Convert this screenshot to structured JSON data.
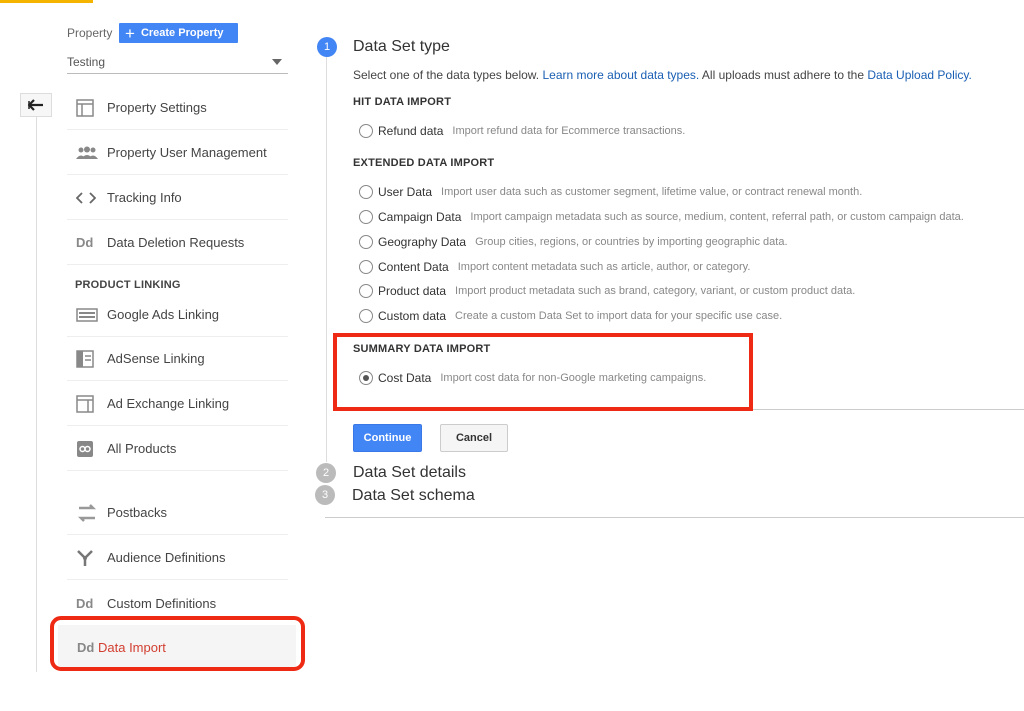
{
  "sidebar": {
    "property_label": "Property",
    "create_property_label": "Create Property",
    "property_value": "Testing",
    "items": [
      {
        "label": "Property Settings"
      },
      {
        "label": "Property User Management"
      },
      {
        "label": "Tracking Info"
      },
      {
        "label": "Data Deletion Requests",
        "icon_text": "Dd"
      }
    ],
    "product_linking_header": "PRODUCT LINKING",
    "linking_items": [
      {
        "label": "Google Ads Linking"
      },
      {
        "label": "AdSense Linking"
      },
      {
        "label": "Ad Exchange Linking"
      },
      {
        "label": "All Products"
      }
    ],
    "more_items": [
      {
        "label": "Postbacks"
      },
      {
        "label": "Audience Definitions"
      },
      {
        "label": "Custom Definitions",
        "icon_text": "Dd"
      },
      {
        "label": "Data Import",
        "icon_text": "Dd",
        "active": true
      }
    ]
  },
  "main": {
    "steps": [
      {
        "number": "1",
        "title": "Data Set type"
      },
      {
        "number": "2",
        "title": "Data Set details"
      },
      {
        "number": "3",
        "title": "Data Set schema"
      }
    ],
    "description": {
      "prefix": "Select one of the data types below. ",
      "link1": "Learn more about data types.",
      "middle": " All uploads must adhere to the ",
      "link2": "Data Upload Policy."
    },
    "groups": {
      "hit": {
        "title": "HIT DATA IMPORT",
        "options": [
          {
            "name": "Refund data",
            "note": "Import refund data for Ecommerce transactions."
          }
        ]
      },
      "extended": {
        "title": "EXTENDED DATA IMPORT",
        "options": [
          {
            "name": "User Data",
            "note": "Import user data such as customer segment, lifetime value, or contract renewal month."
          },
          {
            "name": "Campaign Data",
            "note": "Import campaign metadata such as source, medium, content, referral path, or custom campaign data."
          },
          {
            "name": "Geography Data",
            "note": "Group cities, regions, or countries by importing geographic data."
          },
          {
            "name": "Content Data",
            "note": "Import content metadata such as article, author, or category."
          },
          {
            "name": "Product data",
            "note": "Import product metadata such as brand, category, variant, or custom product data."
          },
          {
            "name": "Custom data",
            "note": "Create a custom Data Set to import data for your specific use case."
          }
        ]
      },
      "summary": {
        "title": "SUMMARY DATA IMPORT",
        "options": [
          {
            "name": "Cost Data",
            "note": "Import cost data for non-Google marketing campaigns.",
            "selected": true
          }
        ]
      }
    },
    "buttons": {
      "continue": "Continue",
      "cancel": "Cancel"
    }
  },
  "colors": {
    "accent": "#4285f4",
    "highlight": "#ee2a14",
    "active_text": "#d23f31"
  }
}
